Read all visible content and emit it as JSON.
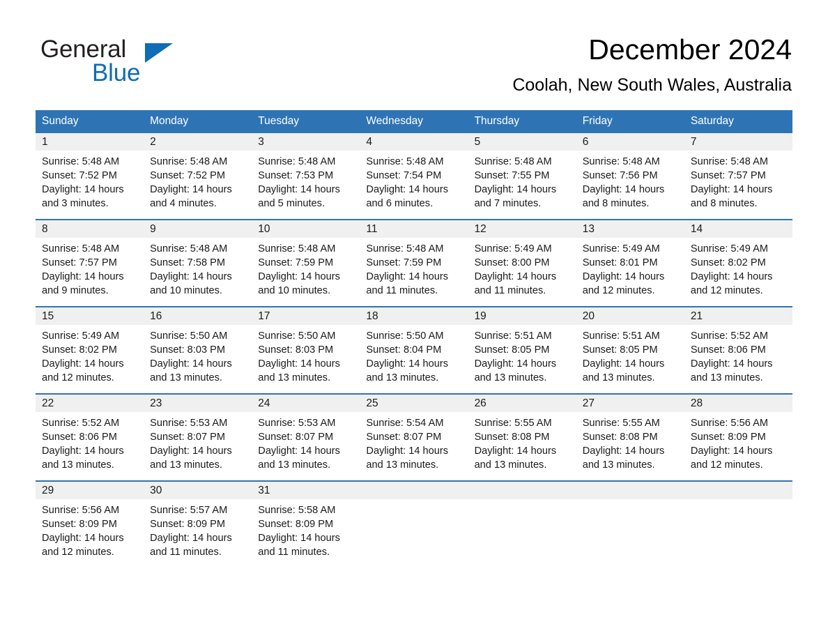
{
  "brand": {
    "logo_text_primary": "General",
    "logo_text_secondary": "Blue",
    "logo_blue_hex": "#0f6cb6",
    "logo_black_hex": "#231f20"
  },
  "header": {
    "month_title": "December 2024",
    "location": "Coolah, New South Wales, Australia"
  },
  "theme": {
    "header_blue_hex": "#2e74b5",
    "daynum_band_hex": "#f0f0f0",
    "page_background_hex": "#ffffff",
    "text_hex": "#1a1a1a"
  },
  "calendar": {
    "day_headers": [
      "Sunday",
      "Monday",
      "Tuesday",
      "Wednesday",
      "Thursday",
      "Friday",
      "Saturday"
    ],
    "weeks": [
      [
        {
          "day": "1",
          "sunrise": "Sunrise: 5:48 AM",
          "sunset": "Sunset: 7:52 PM",
          "daylight_line1": "Daylight: 14 hours",
          "daylight_line2": "and 3 minutes."
        },
        {
          "day": "2",
          "sunrise": "Sunrise: 5:48 AM",
          "sunset": "Sunset: 7:52 PM",
          "daylight_line1": "Daylight: 14 hours",
          "daylight_line2": "and 4 minutes."
        },
        {
          "day": "3",
          "sunrise": "Sunrise: 5:48 AM",
          "sunset": "Sunset: 7:53 PM",
          "daylight_line1": "Daylight: 14 hours",
          "daylight_line2": "and 5 minutes."
        },
        {
          "day": "4",
          "sunrise": "Sunrise: 5:48 AM",
          "sunset": "Sunset: 7:54 PM",
          "daylight_line1": "Daylight: 14 hours",
          "daylight_line2": "and 6 minutes."
        },
        {
          "day": "5",
          "sunrise": "Sunrise: 5:48 AM",
          "sunset": "Sunset: 7:55 PM",
          "daylight_line1": "Daylight: 14 hours",
          "daylight_line2": "and 7 minutes."
        },
        {
          "day": "6",
          "sunrise": "Sunrise: 5:48 AM",
          "sunset": "Sunset: 7:56 PM",
          "daylight_line1": "Daylight: 14 hours",
          "daylight_line2": "and 8 minutes."
        },
        {
          "day": "7",
          "sunrise": "Sunrise: 5:48 AM",
          "sunset": "Sunset: 7:57 PM",
          "daylight_line1": "Daylight: 14 hours",
          "daylight_line2": "and 8 minutes."
        }
      ],
      [
        {
          "day": "8",
          "sunrise": "Sunrise: 5:48 AM",
          "sunset": "Sunset: 7:57 PM",
          "daylight_line1": "Daylight: 14 hours",
          "daylight_line2": "and 9 minutes."
        },
        {
          "day": "9",
          "sunrise": "Sunrise: 5:48 AM",
          "sunset": "Sunset: 7:58 PM",
          "daylight_line1": "Daylight: 14 hours",
          "daylight_line2": "and 10 minutes."
        },
        {
          "day": "10",
          "sunrise": "Sunrise: 5:48 AM",
          "sunset": "Sunset: 7:59 PM",
          "daylight_line1": "Daylight: 14 hours",
          "daylight_line2": "and 10 minutes."
        },
        {
          "day": "11",
          "sunrise": "Sunrise: 5:48 AM",
          "sunset": "Sunset: 7:59 PM",
          "daylight_line1": "Daylight: 14 hours",
          "daylight_line2": "and 11 minutes."
        },
        {
          "day": "12",
          "sunrise": "Sunrise: 5:49 AM",
          "sunset": "Sunset: 8:00 PM",
          "daylight_line1": "Daylight: 14 hours",
          "daylight_line2": "and 11 minutes."
        },
        {
          "day": "13",
          "sunrise": "Sunrise: 5:49 AM",
          "sunset": "Sunset: 8:01 PM",
          "daylight_line1": "Daylight: 14 hours",
          "daylight_line2": "and 12 minutes."
        },
        {
          "day": "14",
          "sunrise": "Sunrise: 5:49 AM",
          "sunset": "Sunset: 8:02 PM",
          "daylight_line1": "Daylight: 14 hours",
          "daylight_line2": "and 12 minutes."
        }
      ],
      [
        {
          "day": "15",
          "sunrise": "Sunrise: 5:49 AM",
          "sunset": "Sunset: 8:02 PM",
          "daylight_line1": "Daylight: 14 hours",
          "daylight_line2": "and 12 minutes."
        },
        {
          "day": "16",
          "sunrise": "Sunrise: 5:50 AM",
          "sunset": "Sunset: 8:03 PM",
          "daylight_line1": "Daylight: 14 hours",
          "daylight_line2": "and 13 minutes."
        },
        {
          "day": "17",
          "sunrise": "Sunrise: 5:50 AM",
          "sunset": "Sunset: 8:03 PM",
          "daylight_line1": "Daylight: 14 hours",
          "daylight_line2": "and 13 minutes."
        },
        {
          "day": "18",
          "sunrise": "Sunrise: 5:50 AM",
          "sunset": "Sunset: 8:04 PM",
          "daylight_line1": "Daylight: 14 hours",
          "daylight_line2": "and 13 minutes."
        },
        {
          "day": "19",
          "sunrise": "Sunrise: 5:51 AM",
          "sunset": "Sunset: 8:05 PM",
          "daylight_line1": "Daylight: 14 hours",
          "daylight_line2": "and 13 minutes."
        },
        {
          "day": "20",
          "sunrise": "Sunrise: 5:51 AM",
          "sunset": "Sunset: 8:05 PM",
          "daylight_line1": "Daylight: 14 hours",
          "daylight_line2": "and 13 minutes."
        },
        {
          "day": "21",
          "sunrise": "Sunrise: 5:52 AM",
          "sunset": "Sunset: 8:06 PM",
          "daylight_line1": "Daylight: 14 hours",
          "daylight_line2": "and 13 minutes."
        }
      ],
      [
        {
          "day": "22",
          "sunrise": "Sunrise: 5:52 AM",
          "sunset": "Sunset: 8:06 PM",
          "daylight_line1": "Daylight: 14 hours",
          "daylight_line2": "and 13 minutes."
        },
        {
          "day": "23",
          "sunrise": "Sunrise: 5:53 AM",
          "sunset": "Sunset: 8:07 PM",
          "daylight_line1": "Daylight: 14 hours",
          "daylight_line2": "and 13 minutes."
        },
        {
          "day": "24",
          "sunrise": "Sunrise: 5:53 AM",
          "sunset": "Sunset: 8:07 PM",
          "daylight_line1": "Daylight: 14 hours",
          "daylight_line2": "and 13 minutes."
        },
        {
          "day": "25",
          "sunrise": "Sunrise: 5:54 AM",
          "sunset": "Sunset: 8:07 PM",
          "daylight_line1": "Daylight: 14 hours",
          "daylight_line2": "and 13 minutes."
        },
        {
          "day": "26",
          "sunrise": "Sunrise: 5:55 AM",
          "sunset": "Sunset: 8:08 PM",
          "daylight_line1": "Daylight: 14 hours",
          "daylight_line2": "and 13 minutes."
        },
        {
          "day": "27",
          "sunrise": "Sunrise: 5:55 AM",
          "sunset": "Sunset: 8:08 PM",
          "daylight_line1": "Daylight: 14 hours",
          "daylight_line2": "and 13 minutes."
        },
        {
          "day": "28",
          "sunrise": "Sunrise: 5:56 AM",
          "sunset": "Sunset: 8:09 PM",
          "daylight_line1": "Daylight: 14 hours",
          "daylight_line2": "and 12 minutes."
        }
      ],
      [
        {
          "day": "29",
          "sunrise": "Sunrise: 5:56 AM",
          "sunset": "Sunset: 8:09 PM",
          "daylight_line1": "Daylight: 14 hours",
          "daylight_line2": "and 12 minutes."
        },
        {
          "day": "30",
          "sunrise": "Sunrise: 5:57 AM",
          "sunset": "Sunset: 8:09 PM",
          "daylight_line1": "Daylight: 14 hours",
          "daylight_line2": "and 11 minutes."
        },
        {
          "day": "31",
          "sunrise": "Sunrise: 5:58 AM",
          "sunset": "Sunset: 8:09 PM",
          "daylight_line1": "Daylight: 14 hours",
          "daylight_line2": "and 11 minutes."
        },
        {
          "day": "",
          "sunrise": "",
          "sunset": "",
          "daylight_line1": "",
          "daylight_line2": ""
        },
        {
          "day": "",
          "sunrise": "",
          "sunset": "",
          "daylight_line1": "",
          "daylight_line2": ""
        },
        {
          "day": "",
          "sunrise": "",
          "sunset": "",
          "daylight_line1": "",
          "daylight_line2": ""
        },
        {
          "day": "",
          "sunrise": "",
          "sunset": "",
          "daylight_line1": "",
          "daylight_line2": ""
        }
      ]
    ]
  }
}
